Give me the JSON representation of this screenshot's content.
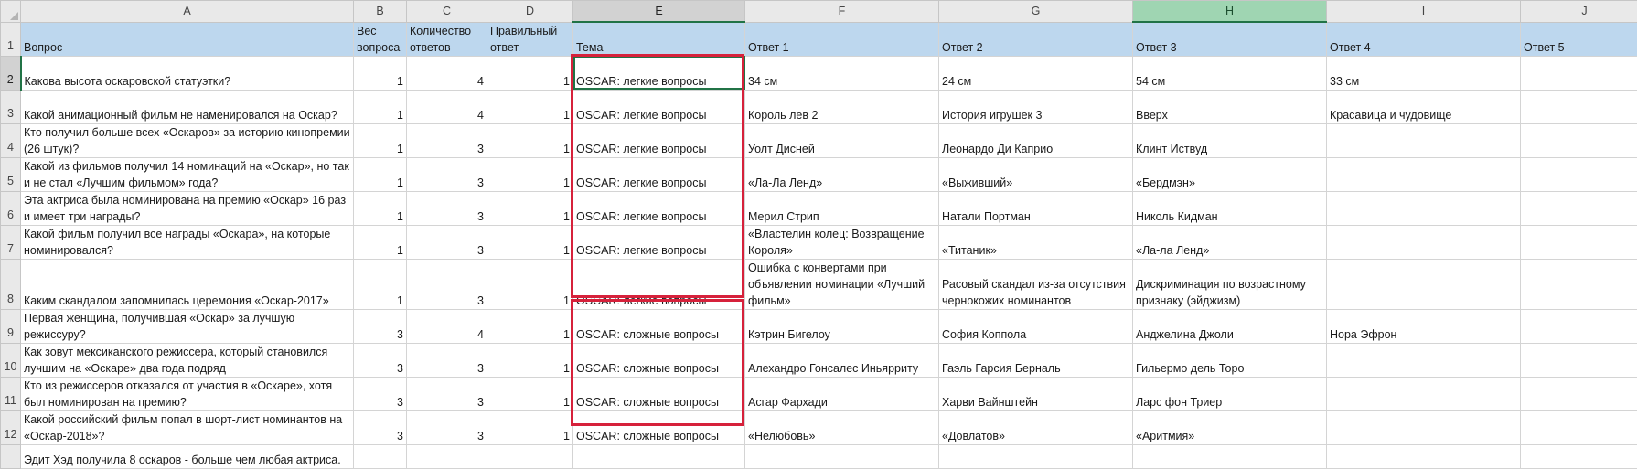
{
  "columns": [
    "A",
    "B",
    "C",
    "D",
    "E",
    "F",
    "G",
    "H",
    "I",
    "J"
  ],
  "selected_column": "E",
  "highlighted_column": "H",
  "header": {
    "row_number": "1",
    "a": "Вопрос",
    "b": "Вес вопроса",
    "c": "Количество ответов",
    "d": "Правильный ответ",
    "e": "Тема",
    "f": "Ответ 1",
    "g": "Ответ 2",
    "h": "Ответ 3",
    "i": "Ответ 4",
    "j": "Ответ 5"
  },
  "rows": [
    {
      "n": "2",
      "a": "Какова высота оскаровской статуэтки?",
      "b": "1",
      "c": "4",
      "d": "1",
      "e": "OSCAR: легкие вопросы",
      "f": "34 см",
      "g": "24 см",
      "h": "54 см",
      "i": "33 см",
      "j": ""
    },
    {
      "n": "3",
      "a": "Какой анимационный фильм не наменировался на Оскар?",
      "b": "1",
      "c": "4",
      "d": "1",
      "e": "OSCAR: легкие вопросы",
      "f": "Король лев 2",
      "g": "История игрушек 3",
      "h": "Вверх",
      "i": "Красавица и чудовище",
      "j": ""
    },
    {
      "n": "4",
      "a": "Кто получил больше всех «Оскаров» за историю кинопремии (26 штук)?",
      "b": "1",
      "c": "3",
      "d": "1",
      "e": "OSCAR: легкие вопросы",
      "f": "Уолт Дисней",
      "g": "Леонардо Ди Каприо",
      "h": "Клинт Иствуд",
      "i": "",
      "j": ""
    },
    {
      "n": "5",
      "a": "Какой из фильмов получил 14 номинаций на «Оскар», но так и не стал «Лучшим фильмом» года?",
      "b": "1",
      "c": "3",
      "d": "1",
      "e": "OSCAR: легкие вопросы",
      "f": "«Ла-Ла Ленд»",
      "g": "«Выживший»",
      "h": "«Бердмэн»",
      "i": "",
      "j": ""
    },
    {
      "n": "6",
      "a": "Эта актриса была номинирована на премию «Оскар» 16 раз и имеет три награды?",
      "b": "1",
      "c": "3",
      "d": "1",
      "e": "OSCAR: легкие вопросы",
      "f": "Мерил Стрип",
      "g": "Натали Портман",
      "h": "Николь Кидман",
      "i": "",
      "j": ""
    },
    {
      "n": "7",
      "a": "Какой фильм получил все награды «Оскара», на которые номинировался?",
      "b": "1",
      "c": "3",
      "d": "1",
      "e": "OSCAR: легкие вопросы",
      "f": "«Властелин колец: Возвращение Короля»",
      "g": "«Титаник»",
      "h": "«Ла-ла Ленд»",
      "i": "",
      "j": ""
    },
    {
      "n": "8",
      "a": "Каким скандалом запомнилась церемония «Оскар-2017»",
      "b": "1",
      "c": "3",
      "d": "1",
      "e": "OSCAR: легкие вопросы",
      "f": "Ошибка с конвертами при объявлении номинации «Лучший фильм»",
      "g": "Расовый скандал из-за отсутствия чернокожих номинантов",
      "h": "Дискриминация по возрастному признаку (эйджизм)",
      "i": "",
      "j": ""
    },
    {
      "n": "9",
      "a": "Первая женщина, получившая «Оскар» за лучшую режиссуру?",
      "b": "3",
      "c": "4",
      "d": "1",
      "e": "OSCAR: сложные вопросы",
      "f": "Кэтрин Бигелоу",
      "g": "София Коппола",
      "h": "Анджелина Джоли",
      "i": "Нора Эфрон",
      "j": ""
    },
    {
      "n": "10",
      "a": "Как зовут мексиканского режиссера, который становился лучшим на «Оскаре» два года подряд",
      "b": "3",
      "c": "3",
      "d": "1",
      "e": "OSCAR: сложные вопросы",
      "f": "Алехандро Гонсалес Иньярриту",
      "g": "Гаэль Гарсия Берналь",
      "h": "Гильермо дель Торо",
      "i": "",
      "j": ""
    },
    {
      "n": "11",
      "a": "Кто из режиссеров отказался от участия в «Оскаре», хотя был номинирован на премию?",
      "b": "3",
      "c": "3",
      "d": "1",
      "e": "OSCAR: сложные вопросы",
      "f": "Асгар Фархади",
      "g": "Харви Вайнштейн",
      "h": "Ларс фон Триер",
      "i": "",
      "j": ""
    },
    {
      "n": "12",
      "a": "Какой российский фильм попал в шорт-лист номинантов на «Оскар-2018»?",
      "b": "3",
      "c": "3",
      "d": "1",
      "e": "OSCAR: сложные вопросы",
      "f": "«Нелюбовь»",
      "g": "«Довлатов»",
      "h": "«Аритмия»",
      "i": "",
      "j": ""
    },
    {
      "n": "",
      "a": "Эдит Хэд получила 8 оскаров - больше чем любая актриса.",
      "b": "",
      "c": "",
      "d": "",
      "e": "",
      "f": "",
      "g": "",
      "h": "",
      "i": "",
      "j": ""
    }
  ]
}
